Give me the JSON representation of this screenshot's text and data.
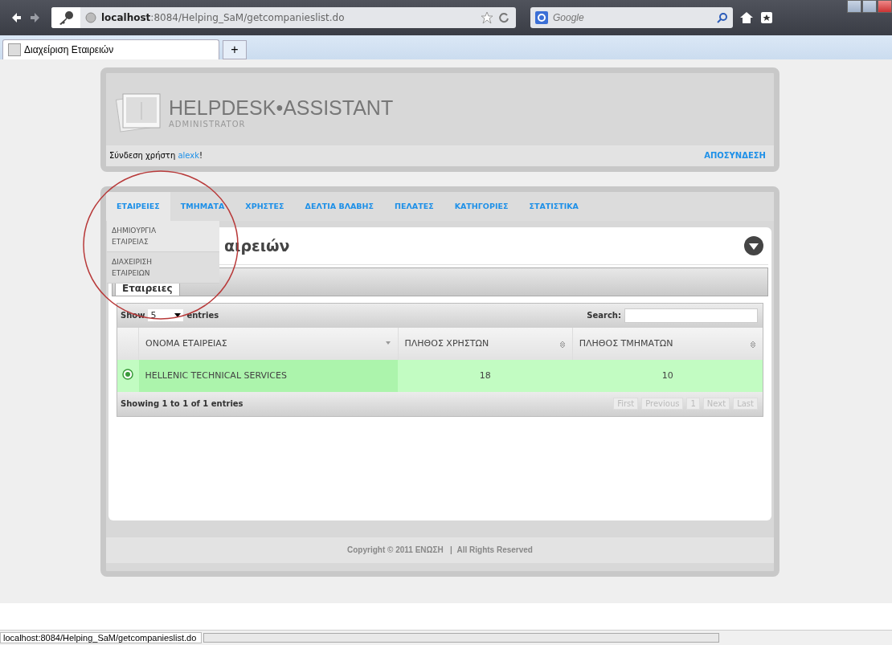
{
  "browser": {
    "url": "**localhost**:8084/Helping_SaM/getcompanieslist.do",
    "search_placeholder": "Google",
    "tab_title": "Διαχείριση Εταιρειών",
    "new_tab": "+"
  },
  "header": {
    "title": "HELPDESK•ASSISTANT",
    "subtitle": "ADMINISTRATOR",
    "login_text": "Σύνδεση χρήστη",
    "user": "alexk",
    "suffix": "!",
    "logout": "ΑΠΟΣΥΝΔΕΣΗ"
  },
  "nav": [
    {
      "label": "ΕΤΑΙΡΕΙΕΣ",
      "selected": true
    },
    {
      "label": "ΤΜΗΜΑΤΑ",
      "selected": false
    },
    {
      "label": "ΧΡΗΣΤΕΣ",
      "selected": false
    },
    {
      "label": "ΔΕΛΤΙΑ ΒΛΑΒΗΣ",
      "selected": false
    },
    {
      "label": "ΠΕΛΑΤΕΣ",
      "selected": false
    },
    {
      "label": "ΚΑΤΗΓΟΡΙΕΣ",
      "selected": false
    },
    {
      "label": "ΣΤΑΤΙΣΤΙΚΑ",
      "selected": false
    }
  ],
  "dropdown": [
    "ΔΗΜΙΟΥΡΓΙΑ ΕΤΑΙΡΕΙΑΣ",
    "ΔΙΑΧΕΙΡΙΣΗ ΕΤΑΙΡΕΙΩΝ"
  ],
  "heading": "αιρειών",
  "tabs": [
    {
      "label": "Εταιρειες",
      "selected": true
    }
  ],
  "table": {
    "show": "Show",
    "length": "5",
    "entries": "entries",
    "search_label": "Search:",
    "columns": [
      {
        "label": "ΟΝΟΜΑ ΕΤΑΙΡΕΙΑΣ",
        "sorted": true
      },
      {
        "label": "ΠΛΗΘΟΣ ΧΡΗΣΤΩΝ",
        "sorted": false
      },
      {
        "label": "ΠΛΗΘΟΣ ΤΜΗΜΑΤΩΝ",
        "sorted": false
      }
    ],
    "rows": [
      {
        "name": "HELLENIC TECHNICAL SERVICES",
        "users": "18",
        "departments": "10"
      }
    ],
    "info": "Showing 1 to 1 of 1 entries",
    "pager": [
      "First",
      "Previous",
      "1",
      "Next",
      "Last"
    ]
  },
  "footer": "Copyright © 2011 ΕΝΩΣΗ   |  All Rights Reserved",
  "status_url": "localhost:8084/Helping_SaM/getcompanieslist.do"
}
